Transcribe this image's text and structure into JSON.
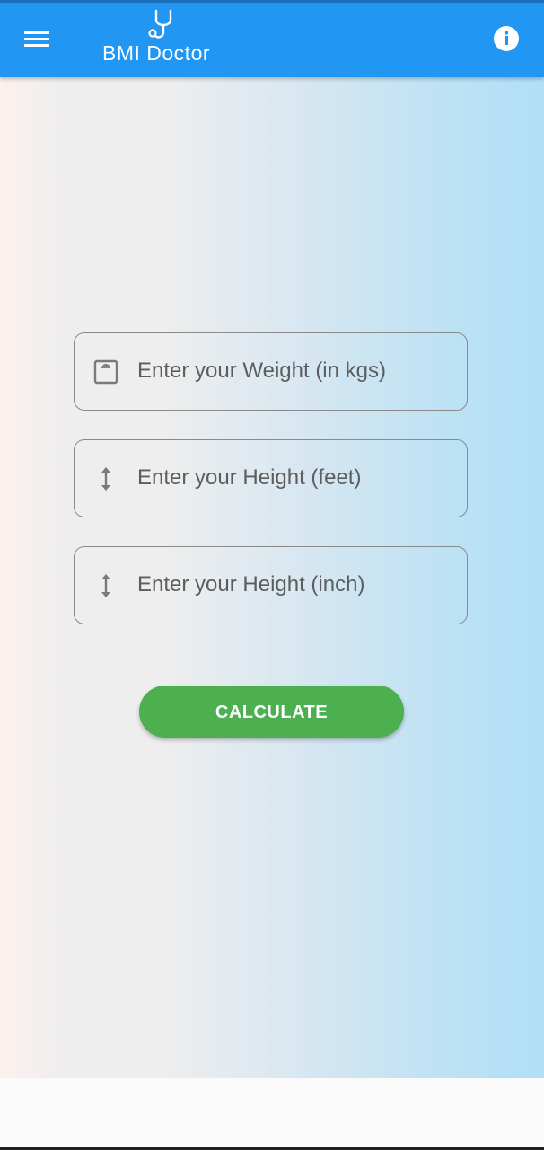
{
  "app": {
    "title": "BMI Doctor"
  },
  "header": {
    "menu_icon": "hamburger-menu-icon",
    "logo_icon": "stethoscope-icon",
    "info_icon": "info-icon"
  },
  "form": {
    "weight": {
      "placeholder": "Enter your Weight (in kgs)",
      "value": "",
      "icon": "scale-icon"
    },
    "height_feet": {
      "placeholder": "Enter your Height (feet)",
      "value": "",
      "icon": "vertical-arrows-icon"
    },
    "height_inch": {
      "placeholder": "Enter your Height (inch)",
      "value": "",
      "icon": "vertical-arrows-icon"
    },
    "calculate_label": "CALCULATE"
  },
  "colors": {
    "app_bar": "#2196f3",
    "button": "#4caf50",
    "field_border": "#8a8a8a"
  }
}
